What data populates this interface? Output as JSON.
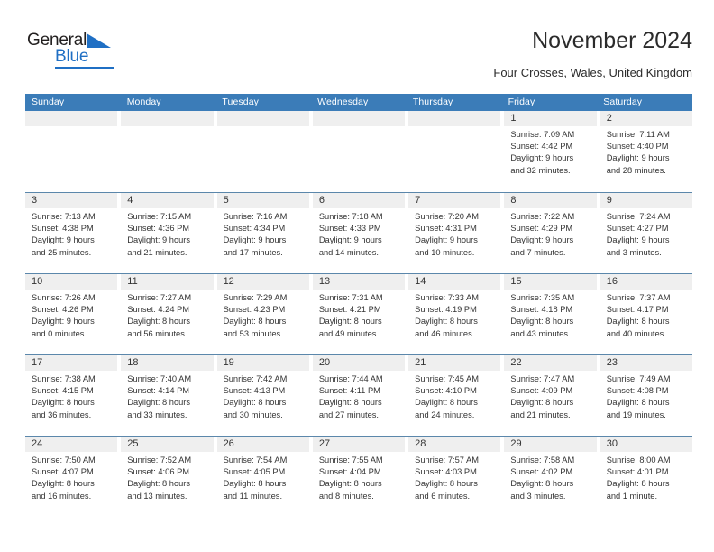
{
  "logo": {
    "word1": "General",
    "word2": "Blue",
    "triangle_icon": "triangle-icon",
    "color_black": "#221f1f",
    "color_blue": "#1f6fc4"
  },
  "header": {
    "title": "November 2024",
    "subtitle": "Four Crosses, Wales, United Kingdom",
    "accent_color": "#3b7cb8"
  },
  "weekdays": [
    "Sunday",
    "Monday",
    "Tuesday",
    "Wednesday",
    "Thursday",
    "Friday",
    "Saturday"
  ],
  "weeks": [
    [
      {
        "date": "",
        "lines": []
      },
      {
        "date": "",
        "lines": []
      },
      {
        "date": "",
        "lines": []
      },
      {
        "date": "",
        "lines": []
      },
      {
        "date": "",
        "lines": []
      },
      {
        "date": "1",
        "lines": [
          "Sunrise: 7:09 AM",
          "Sunset: 4:42 PM",
          "Daylight: 9 hours",
          "and 32 minutes."
        ]
      },
      {
        "date": "2",
        "lines": [
          "Sunrise: 7:11 AM",
          "Sunset: 4:40 PM",
          "Daylight: 9 hours",
          "and 28 minutes."
        ]
      }
    ],
    [
      {
        "date": "3",
        "lines": [
          "Sunrise: 7:13 AM",
          "Sunset: 4:38 PM",
          "Daylight: 9 hours",
          "and 25 minutes."
        ]
      },
      {
        "date": "4",
        "lines": [
          "Sunrise: 7:15 AM",
          "Sunset: 4:36 PM",
          "Daylight: 9 hours",
          "and 21 minutes."
        ]
      },
      {
        "date": "5",
        "lines": [
          "Sunrise: 7:16 AM",
          "Sunset: 4:34 PM",
          "Daylight: 9 hours",
          "and 17 minutes."
        ]
      },
      {
        "date": "6",
        "lines": [
          "Sunrise: 7:18 AM",
          "Sunset: 4:33 PM",
          "Daylight: 9 hours",
          "and 14 minutes."
        ]
      },
      {
        "date": "7",
        "lines": [
          "Sunrise: 7:20 AM",
          "Sunset: 4:31 PM",
          "Daylight: 9 hours",
          "and 10 minutes."
        ]
      },
      {
        "date": "8",
        "lines": [
          "Sunrise: 7:22 AM",
          "Sunset: 4:29 PM",
          "Daylight: 9 hours",
          "and 7 minutes."
        ]
      },
      {
        "date": "9",
        "lines": [
          "Sunrise: 7:24 AM",
          "Sunset: 4:27 PM",
          "Daylight: 9 hours",
          "and 3 minutes."
        ]
      }
    ],
    [
      {
        "date": "10",
        "lines": [
          "Sunrise: 7:26 AM",
          "Sunset: 4:26 PM",
          "Daylight: 9 hours",
          "and 0 minutes."
        ]
      },
      {
        "date": "11",
        "lines": [
          "Sunrise: 7:27 AM",
          "Sunset: 4:24 PM",
          "Daylight: 8 hours",
          "and 56 minutes."
        ]
      },
      {
        "date": "12",
        "lines": [
          "Sunrise: 7:29 AM",
          "Sunset: 4:23 PM",
          "Daylight: 8 hours",
          "and 53 minutes."
        ]
      },
      {
        "date": "13",
        "lines": [
          "Sunrise: 7:31 AM",
          "Sunset: 4:21 PM",
          "Daylight: 8 hours",
          "and 49 minutes."
        ]
      },
      {
        "date": "14",
        "lines": [
          "Sunrise: 7:33 AM",
          "Sunset: 4:19 PM",
          "Daylight: 8 hours",
          "and 46 minutes."
        ]
      },
      {
        "date": "15",
        "lines": [
          "Sunrise: 7:35 AM",
          "Sunset: 4:18 PM",
          "Daylight: 8 hours",
          "and 43 minutes."
        ]
      },
      {
        "date": "16",
        "lines": [
          "Sunrise: 7:37 AM",
          "Sunset: 4:17 PM",
          "Daylight: 8 hours",
          "and 40 minutes."
        ]
      }
    ],
    [
      {
        "date": "17",
        "lines": [
          "Sunrise: 7:38 AM",
          "Sunset: 4:15 PM",
          "Daylight: 8 hours",
          "and 36 minutes."
        ]
      },
      {
        "date": "18",
        "lines": [
          "Sunrise: 7:40 AM",
          "Sunset: 4:14 PM",
          "Daylight: 8 hours",
          "and 33 minutes."
        ]
      },
      {
        "date": "19",
        "lines": [
          "Sunrise: 7:42 AM",
          "Sunset: 4:13 PM",
          "Daylight: 8 hours",
          "and 30 minutes."
        ]
      },
      {
        "date": "20",
        "lines": [
          "Sunrise: 7:44 AM",
          "Sunset: 4:11 PM",
          "Daylight: 8 hours",
          "and 27 minutes."
        ]
      },
      {
        "date": "21",
        "lines": [
          "Sunrise: 7:45 AM",
          "Sunset: 4:10 PM",
          "Daylight: 8 hours",
          "and 24 minutes."
        ]
      },
      {
        "date": "22",
        "lines": [
          "Sunrise: 7:47 AM",
          "Sunset: 4:09 PM",
          "Daylight: 8 hours",
          "and 21 minutes."
        ]
      },
      {
        "date": "23",
        "lines": [
          "Sunrise: 7:49 AM",
          "Sunset: 4:08 PM",
          "Daylight: 8 hours",
          "and 19 minutes."
        ]
      }
    ],
    [
      {
        "date": "24",
        "lines": [
          "Sunrise: 7:50 AM",
          "Sunset: 4:07 PM",
          "Daylight: 8 hours",
          "and 16 minutes."
        ]
      },
      {
        "date": "25",
        "lines": [
          "Sunrise: 7:52 AM",
          "Sunset: 4:06 PM",
          "Daylight: 8 hours",
          "and 13 minutes."
        ]
      },
      {
        "date": "26",
        "lines": [
          "Sunrise: 7:54 AM",
          "Sunset: 4:05 PM",
          "Daylight: 8 hours",
          "and 11 minutes."
        ]
      },
      {
        "date": "27",
        "lines": [
          "Sunrise: 7:55 AM",
          "Sunset: 4:04 PM",
          "Daylight: 8 hours",
          "and 8 minutes."
        ]
      },
      {
        "date": "28",
        "lines": [
          "Sunrise: 7:57 AM",
          "Sunset: 4:03 PM",
          "Daylight: 8 hours",
          "and 6 minutes."
        ]
      },
      {
        "date": "29",
        "lines": [
          "Sunrise: 7:58 AM",
          "Sunset: 4:02 PM",
          "Daylight: 8 hours",
          "and 3 minutes."
        ]
      },
      {
        "date": "30",
        "lines": [
          "Sunrise: 8:00 AM",
          "Sunset: 4:01 PM",
          "Daylight: 8 hours",
          "and 1 minute."
        ]
      }
    ]
  ]
}
